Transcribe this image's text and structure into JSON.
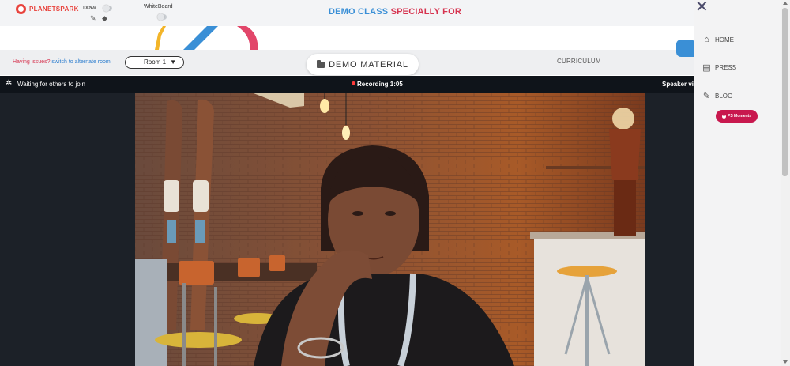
{
  "header": {
    "logo_text": "PLANETSPARK",
    "draw_label": "Draw",
    "whiteboard_label": "WhiteBoard",
    "title_part1": "DEMO CLASS",
    "title_part2": "SPECIALLY FOR"
  },
  "toolbar": {
    "issue_text": "Having issues?",
    "alternate_room_link": "switch to alternate room",
    "room_selected": "Room 1",
    "demo_material_label": "DEMO MATERIAL",
    "curriculum_label": "CURRICULUM"
  },
  "video": {
    "status_text": "Waiting for others to join",
    "recording_text": "Recording 1:05",
    "view_text": "Speaker vi"
  },
  "side_menu": {
    "items": [
      {
        "label": "HOME",
        "icon": "home-icon"
      },
      {
        "label": "PRESS",
        "icon": "newspaper-icon"
      },
      {
        "label": "BLOG",
        "icon": "pencil-icon"
      }
    ],
    "moments_label": "PS Moments"
  },
  "colors": {
    "brand_red": "#e8433d",
    "title_blue": "#3a8fd6",
    "title_red": "#d6334f",
    "moments_bg": "#c8184e",
    "video_bg": "#1c2128"
  }
}
